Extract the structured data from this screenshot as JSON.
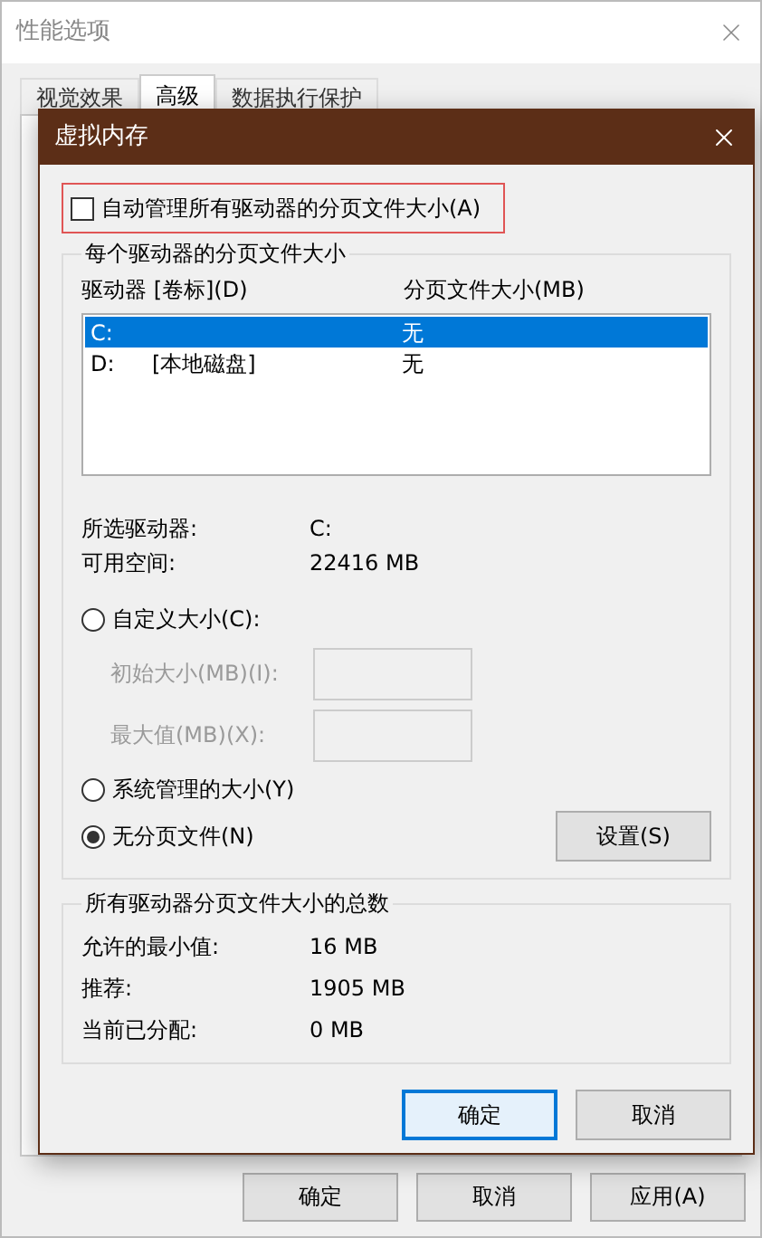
{
  "background_window": {
    "title": "性能选项",
    "tabs": [
      {
        "label": "视觉效果",
        "selected": false
      },
      {
        "label": "高级",
        "selected": true
      },
      {
        "label": "数据执行保护",
        "selected": false
      }
    ],
    "buttons": [
      {
        "label": "确定"
      },
      {
        "label": "取消"
      },
      {
        "label": "应用(A)"
      }
    ]
  },
  "dialog": {
    "title": "虚拟内存",
    "auto_manage": {
      "label": "自动管理所有驱动器的分页文件大小(A)",
      "checked": false
    },
    "per_drive": {
      "title": "每个驱动器的分页文件大小",
      "columns": [
        "驱动器 [卷标](D)",
        "分页文件大小(MB)"
      ],
      "rows": [
        {
          "drive": "C:",
          "size": "无",
          "selected": true
        },
        {
          "drive": "D:",
          "volume": "[本地磁盘]",
          "size": "无",
          "selected": false
        }
      ],
      "info": [
        {
          "label": "所选驱动器:",
          "value": "C:"
        },
        {
          "label": "可用空间:",
          "value": "22416 MB"
        }
      ],
      "options": [
        {
          "label": "自定义大小(C):",
          "selected": false,
          "fields": [
            {
              "label": "初始大小(MB)(I):",
              "disabled": true
            },
            {
              "label": "最大值(MB)(X):",
              "disabled": true
            }
          ]
        },
        {
          "label": "系统管理的大小(Y)",
          "selected": false
        },
        {
          "label": "无分页文件(N)",
          "selected": true
        }
      ],
      "set_button": "设置(S)"
    },
    "totals": {
      "title": "所有驱动器分页文件大小的总数",
      "rows": [
        {
          "label": "允许的最小值:",
          "value": "16 MB"
        },
        {
          "label": "推荐:",
          "value": "1905 MB"
        },
        {
          "label": "当前已分配:",
          "value": "0 MB"
        }
      ]
    },
    "buttons": [
      {
        "label": "确定",
        "default": true
      },
      {
        "label": "取消",
        "default": false
      }
    ]
  }
}
